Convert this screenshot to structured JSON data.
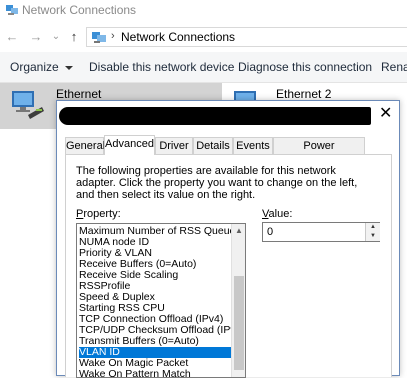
{
  "window": {
    "title": "Network Connections"
  },
  "address": {
    "path": "Network Connections",
    "chevron": "›"
  },
  "nav": {
    "back": "←",
    "forward": "→",
    "dropdown": "⌄",
    "up": "↑"
  },
  "toolbar": {
    "organize": "Organize",
    "disable": "Disable this network device",
    "diagnose": "Diagnose this connection",
    "rename": "Rena"
  },
  "connections": [
    {
      "label": "Ethernet"
    },
    {
      "label": "Ethernet 2"
    }
  ],
  "dialog": {
    "close": "✕",
    "tabs": [
      "General",
      "Advanced",
      "Driver",
      "Details",
      "Events",
      "Power Management"
    ],
    "active_tab": "Advanced",
    "description": "The following properties are available for this network adapter. Click the property you want to change on the left, and then select its value on the right.",
    "property_label_key": "P",
    "property_label_rest": "roperty:",
    "value_label_key": "V",
    "value_label_rest": "alue:",
    "properties": [
      "Maximum Number of RSS Queues",
      "NUMA node ID",
      "Priority & VLAN",
      "Receive Buffers (0=Auto)",
      "Receive Side Scaling",
      "RSSProfile",
      "Speed & Duplex",
      "Starting RSS CPU",
      "TCP Connection Offload (IPv4)",
      "TCP/UDP Checksum Offload (IPv4",
      "Transmit Buffers (0=Auto)",
      "VLAN ID",
      "Wake On Magic Packet",
      "Wake On Pattern Match"
    ],
    "selected_property": "VLAN ID",
    "value": "0",
    "spin_up": "▲",
    "spin_down": "▼",
    "scroll_up": "▲"
  }
}
